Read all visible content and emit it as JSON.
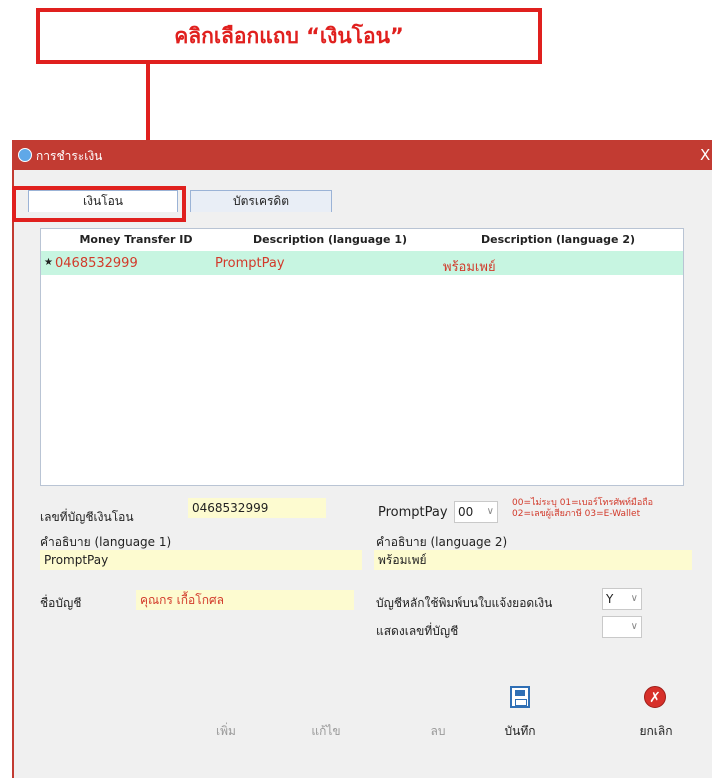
{
  "annotation": {
    "text": "คลิกเลือกแถบ “เงินโอน”"
  },
  "window": {
    "title": "การชำระเงิน",
    "close_glyph": "X"
  },
  "tabs": [
    {
      "label": "เงินโอน",
      "active": true
    },
    {
      "label": "บัตรเครดิต",
      "active": false
    }
  ],
  "grid": {
    "columns": [
      "Money Transfer ID",
      "Description (language 1)",
      "Description (language 2)"
    ],
    "rows": [
      {
        "marker": "★",
        "cells": [
          "0468532999",
          "PromptPay",
          "พร้อมเพย์"
        ]
      }
    ]
  },
  "form": {
    "account_number_label": "เลขที่บัญชีเงินโอน",
    "account_number_value": "0468532999",
    "promptpay_label": "PromptPay",
    "promptpay_value": "00",
    "promptpay_note_line1": "00=ไม่ระบุ 01=เบอร์โทรศัพท์มือถือ",
    "promptpay_note_line2": "02=เลขผู้เสียภาษี 03=E-Wallet",
    "desc1_label": "คำอธิบาย (language 1)",
    "desc1_value": "PromptPay",
    "desc2_label": "คำอธิบาย (language 2)",
    "desc2_value": "พร้อมเพย์",
    "account_name_label": "ชื่อบัญชี",
    "account_name_value": "คุณกร เกื้อโกศล",
    "main_account_label": "บัญชีหลักใช้พิมพ์บนใบแจ้งยอดเงิน",
    "main_account_value": "Y",
    "show_account_label": "แสดงเลขที่บัญชี",
    "show_account_value": ""
  },
  "toolbar": {
    "add_label": "เพิ่ม",
    "edit_label": "แก้ไข",
    "delete_label": "ลบ",
    "save_label": "บันทึก",
    "cancel_label": "ยกเลิก"
  },
  "colors": {
    "annotation_red": "#e0201e",
    "titlebar": "#c23b32",
    "selected_row": "#c7f5e1",
    "field_yellow": "#fdfbd0"
  }
}
